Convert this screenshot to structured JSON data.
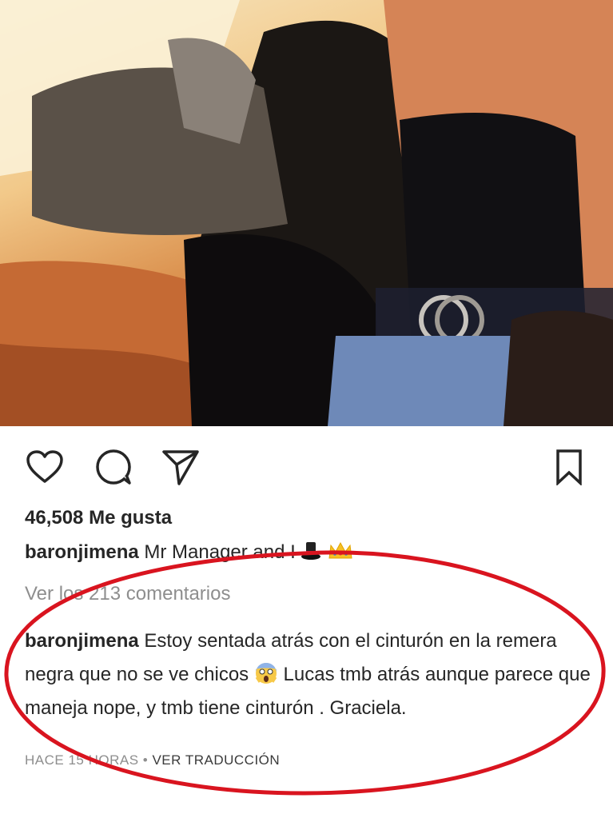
{
  "post": {
    "likes_text": "46,508 Me gusta",
    "caption": {
      "username": "baronjimena",
      "text": "Mr Manager and I"
    },
    "view_comments": "Ver los 213 comentarios",
    "comment": {
      "username": "baronjimena",
      "text_part1": "Estoy sentada atrás con el cinturón en la remera negra que no se ve chicos",
      "text_part2": "Lucas tmb atrás aunque parece que maneja nope, y tmb tiene cinturón . Graciela."
    },
    "time_ago": "HACE 15 HORAS",
    "separator": "•",
    "translate_label": "VER TRADUCCIÓN"
  },
  "icons": {
    "like": "heart-icon",
    "comment": "comment-icon",
    "share": "paper-plane-icon",
    "save": "bookmark-icon",
    "caption_emojis": [
      "top-hat-emoji",
      "crown-emoji"
    ],
    "comment_emoji": "screaming-face-emoji"
  },
  "colors": {
    "highlight_ring": "#d9141f",
    "text_primary": "#262626",
    "text_secondary": "#8e8e8e"
  }
}
